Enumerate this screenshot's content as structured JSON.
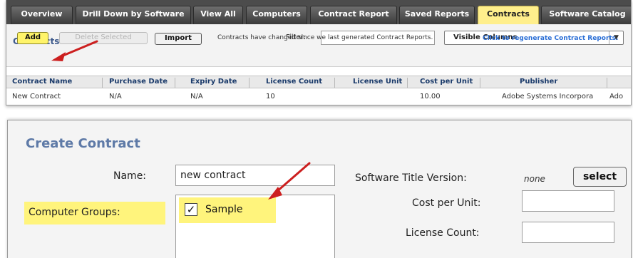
{
  "tabs": [
    {
      "label": "Overview",
      "active": false
    },
    {
      "label": "Drill Down by Software",
      "active": false
    },
    {
      "label": "View All",
      "active": false
    },
    {
      "label": "Computers",
      "active": false
    },
    {
      "label": "Contract Report",
      "active": false
    },
    {
      "label": "Saved Reports",
      "active": false
    },
    {
      "label": "Contracts",
      "active": true
    },
    {
      "label": "Software Catalog",
      "active": false
    }
  ],
  "contracts_panel": {
    "title": "Contracts",
    "filter_label": "Filter:",
    "filter_value": "",
    "visible_columns_label": "Visible Columns",
    "add_label": "Add",
    "delete_label": "Delete Selected",
    "import_label": "Import",
    "notice": "Contracts have changed since we last generated Contract Reports.",
    "regen_link": "Click to regenerate Contract Reports.",
    "columns": [
      "Contract Name",
      "Purchase Date",
      "Expiry Date",
      "License Count",
      "License Unit",
      "Cost per Unit",
      "Publisher"
    ],
    "row": [
      "New Contract",
      "N/A",
      "N/A",
      "10",
      "",
      "10.00",
      "Adobe Systems Incorpora",
      "Ado"
    ]
  },
  "create_contract": {
    "title": "Create Contract",
    "name_label": "Name:",
    "name_value": "new contract",
    "groups_label": "Computer Groups:",
    "group_item": "Sample",
    "group_checked": true,
    "check_glyph": "✓",
    "software_version_label": "Software Title Version:",
    "software_version_value": "none",
    "select_label": "select",
    "cost_label": "Cost per Unit:",
    "license_label": "License Count:"
  },
  "colors": {
    "active_tab": "#ffef8c",
    "highlight": "#fff47c",
    "arrow": "#cc1f1f",
    "link": "#2b6fd6",
    "title": "#5e7aa7"
  },
  "icons": {
    "dropdown": "chevron-down-icon",
    "annotation": "red-arrow-icon"
  },
  "glyphs": {
    "dropdown_arrow": "▼"
  }
}
